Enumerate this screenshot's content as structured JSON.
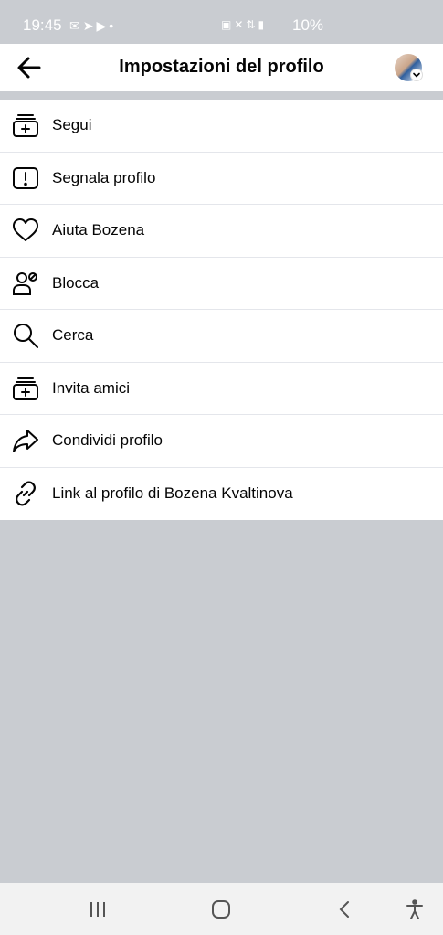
{
  "status_bar": {
    "time": "19:45",
    "left_icons": [
      "gmail-icon",
      "telegram-icon",
      "youtube-icon",
      "dot-icon"
    ],
    "right_icons": [
      "battery-saver-icon",
      "mute-icon",
      "data-4g-icon",
      "signal-icon"
    ],
    "battery": "10%"
  },
  "app_bar": {
    "title": "Impostazioni del profilo"
  },
  "menu": {
    "items": [
      {
        "label": "Segui",
        "icon": "follow-icon"
      },
      {
        "label": "Segnala profilo",
        "icon": "report-icon"
      },
      {
        "label": "Aiuta Bozena",
        "icon": "heart-icon"
      },
      {
        "label": "Blocca",
        "icon": "block-user-icon"
      },
      {
        "label": "Cerca",
        "icon": "search-icon"
      },
      {
        "label": "Invita amici",
        "icon": "invite-icon"
      },
      {
        "label": "Condividi profilo",
        "icon": "share-icon"
      },
      {
        "label": "Link al profilo di Bozena Kvaltinova",
        "icon": "link-icon"
      }
    ]
  },
  "nav_bar": {
    "buttons": [
      "recent-apps-icon",
      "home-icon",
      "back-icon",
      "accessibility-icon"
    ]
  }
}
